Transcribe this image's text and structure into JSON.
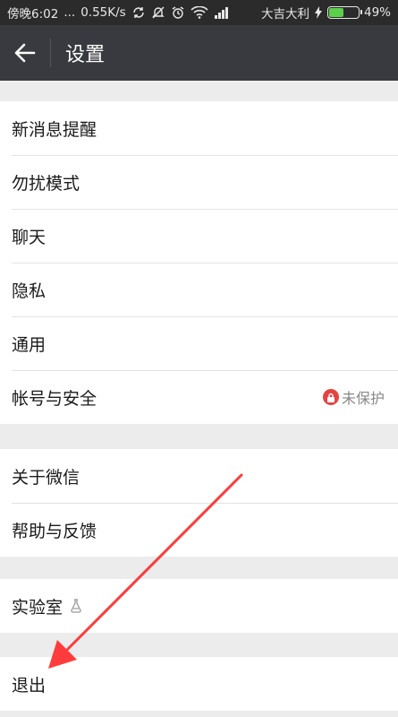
{
  "status_bar": {
    "time": "傍晚6:02",
    "dots": "...",
    "speed": "0.55K/s",
    "carrier": "大吉大利",
    "battery_percent": "49%",
    "battery_level": 0.49
  },
  "header": {
    "title": "设置",
    "background": "#393a3f"
  },
  "groups": [
    {
      "items": [
        {
          "label": "新消息提醒"
        },
        {
          "label": "勿扰模式"
        },
        {
          "label": "聊天"
        },
        {
          "label": "隐私"
        },
        {
          "label": "通用"
        },
        {
          "label": "帐号与安全",
          "status": "未保护"
        }
      ]
    },
    {
      "items": [
        {
          "label": "关于微信"
        },
        {
          "label": "帮助与反馈"
        }
      ]
    },
    {
      "items": [
        {
          "label": "实验室"
        }
      ]
    },
    {
      "items": [
        {
          "label": "退出"
        }
      ]
    }
  ],
  "colors": {
    "accent_red": "#e64340",
    "annotation_arrow": "#ff3b3b",
    "battery_green": "#5bd04a"
  },
  "icons": [
    "back-arrow-icon",
    "lock-icon",
    "lab-flask-icon",
    "wifi-icon",
    "signal-icon",
    "battery-icon",
    "alarm-icon",
    "mute-icon",
    "sync-icon"
  ]
}
